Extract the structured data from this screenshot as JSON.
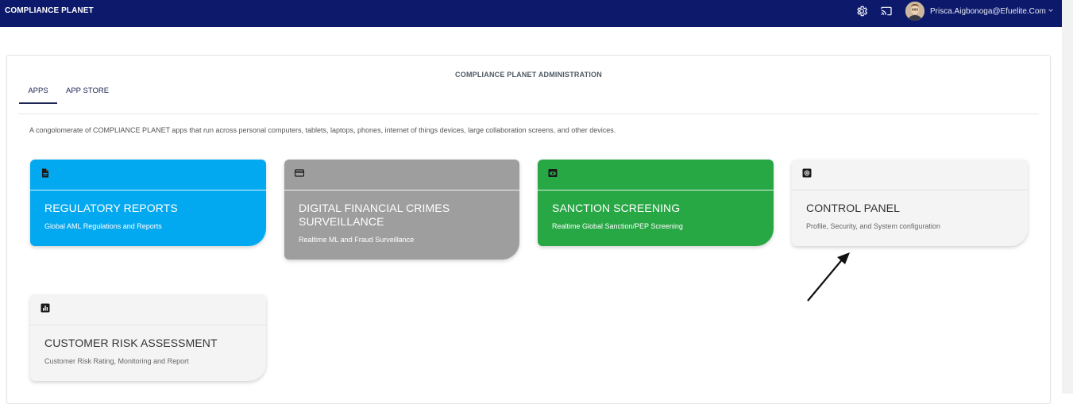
{
  "header": {
    "brand": "COMPLIANCE PLANET",
    "user_email": "Prisca.Aigbonoga@Efuelite.Com",
    "icons": [
      "gear-icon",
      "cast-icon",
      "chevron-down-icon"
    ]
  },
  "panel": {
    "title": "COMPLIANCE PLANET ADMINISTRATION",
    "tabs": [
      {
        "label": "APPS",
        "active": true
      },
      {
        "label": "APP STORE",
        "active": false
      }
    ],
    "description": "A congolomerate of COMPLIANCE PLANET apps that run across personal computers, tablets, laptops, phones, internet of things devices, large collaboration screens, and other devices."
  },
  "apps": [
    {
      "title": "REGULATORY REPORTS",
      "subtitle": "Global AML Regulations and Reports",
      "icon": "document-icon",
      "color": "#03a9f0"
    },
    {
      "title": "DIGITAL FINANCIAL CRIMES SURVEILLANCE",
      "subtitle": "Realtime ML and Fraud Surveillance",
      "icon": "card-icon",
      "color": "#9e9e9e"
    },
    {
      "title": "SANCTION SCREENING",
      "subtitle": "Realtime Global Sanction/PEP Screening",
      "icon": "eye-icon",
      "color": "#28a745"
    },
    {
      "title": "CONTROL PANEL",
      "subtitle": "Profile, Security, and System configuration",
      "icon": "settings-icon",
      "color": "#f4f4f4"
    },
    {
      "title": "CUSTOMER RISK ASSESSMENT",
      "subtitle": "Customer Risk Rating, Monitoring and Report",
      "icon": "bar-chart-icon",
      "color": "#f4f4f4"
    }
  ],
  "colors": {
    "topbar": "#0d1a6b",
    "accent_tab": "#1b2452"
  }
}
